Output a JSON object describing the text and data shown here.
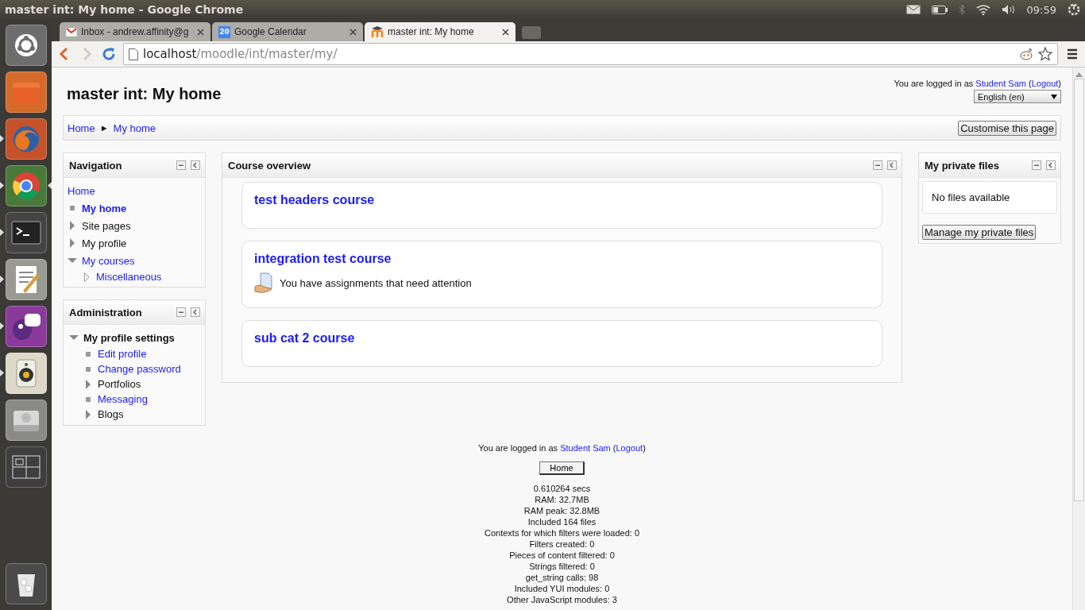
{
  "window": {
    "title": "master int: My home - Google Chrome"
  },
  "system_tray": {
    "clock": "09:59"
  },
  "launcher": {
    "items": [
      {
        "kind": "home",
        "running": false,
        "focused": false
      },
      {
        "kind": "folder",
        "running": false,
        "focused": false
      },
      {
        "kind": "fox-browser",
        "running": true,
        "focused": false
      },
      {
        "kind": "round-browser",
        "running": true,
        "focused": true
      },
      {
        "kind": "terminal",
        "running": true,
        "focused": false
      },
      {
        "kind": "editor",
        "running": true,
        "focused": false
      },
      {
        "kind": "chat",
        "running": true,
        "focused": false
      },
      {
        "kind": "speaker",
        "running": true,
        "focused": false
      },
      {
        "kind": "disk",
        "running": false,
        "focused": false
      },
      {
        "kind": "workspaces",
        "running": false,
        "focused": false
      },
      {
        "kind": "trash",
        "running": false,
        "focused": false
      }
    ]
  },
  "browser": {
    "tabs": [
      {
        "kind": "mail",
        "label": "Inbox - andrew.affinity@g",
        "selected": false
      },
      {
        "kind": "calendar",
        "icon_text": "20",
        "label": "Google Calendar",
        "selected": false
      },
      {
        "kind": "moodle",
        "label": "master int: My home",
        "selected": true
      }
    ],
    "address": {
      "host": "localhost",
      "path": "/moodle/int/master/my/"
    }
  },
  "page": {
    "heading": "master int: My home",
    "login": {
      "text": "You are logged in as",
      "user": "Student Sam",
      "open": "(",
      "logout": "Logout",
      "close": ")"
    },
    "language": "English (en)",
    "breadcrumb": {
      "items": [
        "Home",
        "My home"
      ],
      "separator": "►"
    },
    "customise_button": "Customise this page",
    "navigation": {
      "title": "Navigation",
      "items": [
        {
          "label": "Home",
          "kind": "root",
          "link": true,
          "current": false
        },
        {
          "label": "My home",
          "kind": "leaf",
          "link": true,
          "current": true
        },
        {
          "label": "Site pages",
          "kind": "branch",
          "expanded": false,
          "link": false,
          "current": false
        },
        {
          "label": "My profile",
          "kind": "branch",
          "expanded": false,
          "link": false,
          "current": false
        },
        {
          "label": "My courses",
          "kind": "branch",
          "expanded": true,
          "link": true,
          "current": false,
          "children": [
            {
              "label": "Miscellaneous",
              "kind": "category",
              "link": true,
              "current": false
            }
          ]
        }
      ]
    },
    "administration": {
      "title": "Administration",
      "items": [
        {
          "label": "My profile settings",
          "kind": "branch",
          "expanded": true,
          "link": false,
          "current": true,
          "children": [
            {
              "label": "Edit profile",
              "kind": "leaf",
              "link": true,
              "current": false
            },
            {
              "label": "Change password",
              "kind": "leaf",
              "link": true,
              "current": false
            },
            {
              "label": "Portfolios",
              "kind": "branch",
              "expanded": false,
              "link": false,
              "current": false
            },
            {
              "label": "Messaging",
              "kind": "leaf",
              "link": true,
              "current": false
            },
            {
              "label": "Blogs",
              "kind": "branch",
              "expanded": false,
              "link": false,
              "current": false
            }
          ]
        }
      ]
    },
    "course_overview": {
      "title": "Course overview",
      "courses": [
        {
          "name": "test headers course"
        },
        {
          "name": "integration test course",
          "notice": "You have assignments that need attention"
        },
        {
          "name": "sub cat 2 course"
        }
      ]
    },
    "private_files": {
      "title": "My private files",
      "empty_text": "No files available",
      "button": "Manage my private files"
    },
    "footer": {
      "login": {
        "text": "You are logged in as",
        "user": "Student Sam",
        "open": "(",
        "logout": "Logout",
        "close": ")"
      },
      "home_button": "Home",
      "stats": [
        "0.610264 secs",
        "RAM: 32.7MB",
        "RAM peak: 32.8MB",
        "Included 164 files",
        "Contexts for which filters were loaded: 0",
        "Filters created: 0",
        "Pieces of content filtered: 0",
        "Strings filtered: 0",
        "get_string calls: 98",
        "Included YUI modules: 0",
        "Other JavaScript modules: 3"
      ]
    }
  }
}
